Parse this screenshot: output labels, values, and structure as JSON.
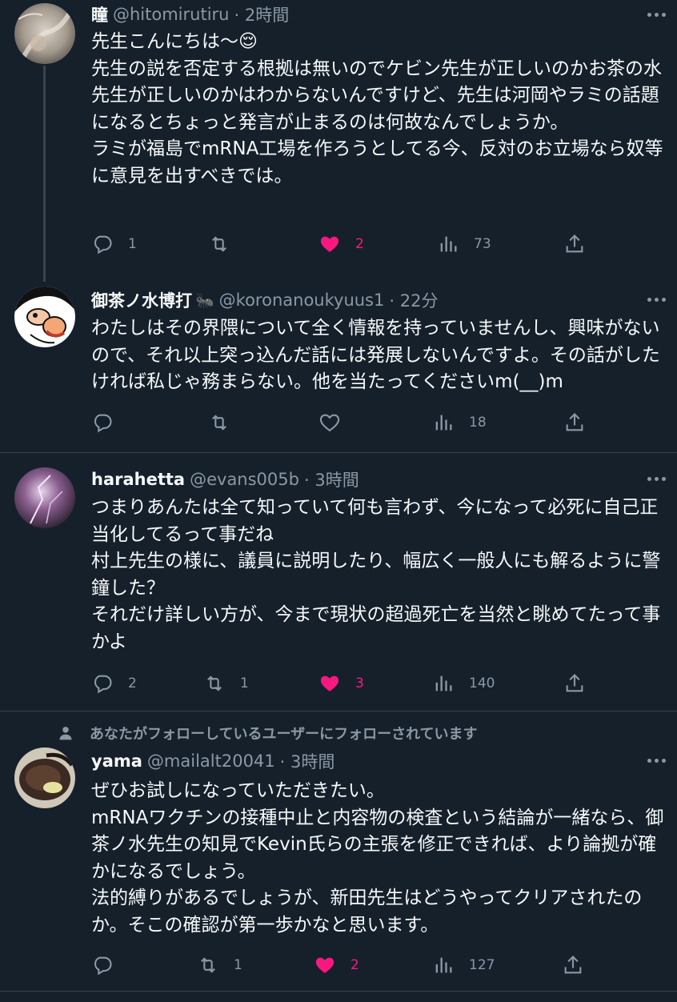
{
  "tweets": [
    {
      "name": "瞳",
      "handle": "@hitomirutiru",
      "time": "· 2時間",
      "text": "先生こんにちは〜😌\n先生の説を否定する根拠は無いのでケビン先生が正しいのかお茶の水先生が正しいのかはわからないんですけど、先生は河岡やラミの話題になるとちょっと発言が止まるのは何故なんでしょうか。\nラミが福島でmRNA工場を作ろうとしてる今、反対のお立場なら奴等に意見を出すべきでは。",
      "reply_count": "1",
      "retweet_count": "",
      "like_count": "2",
      "view_count": "73"
    },
    {
      "name": "御茶ノ水博打",
      "name_emoji": "🐜",
      "handle": "@koronanoukyuus1",
      "time": "· 22分",
      "text": "わたしはその界隈について全く情報を持っていませんし、興味がないので、それ以上突っ込んだ話には発展しないんですよ。その話がしたければ私じゃ務まらない。他を当たってくださいm(__)m",
      "reply_count": "",
      "retweet_count": "",
      "like_count": "",
      "view_count": "18"
    },
    {
      "name": "harahetta",
      "handle": "@evans005b",
      "time": "· 3時間",
      "text": "つまりあんたは全て知っていて何も言わず、今になって必死に自己正当化してるって事だね\n村上先生の様に、議員に説明したり、幅広く一般人にも解るように警鐘した？\nそれだけ詳しい方が、今まで現状の超過死亡を当然と眺めてたって事かよ",
      "reply_count": "2",
      "retweet_count": "1",
      "like_count": "3",
      "view_count": "140"
    },
    {
      "social_context": "あなたがフォローしているユーザーにフォローされています",
      "name": "yama",
      "handle": "@mailalt20041",
      "time": "· 3時間",
      "text": "ぜひお試しになっていただきたい。\nmRNAワクチンの接種中止と内容物の検査という結論が一緒なら、御茶ノ水先生の知見でKevin氏らの主張を修正できれば、より論拠が確かになるでしょう。\n法的縛りがあるでしょうが、新田先生はどうやってクリアされたのか。そこの確認が第一歩かなと思います。",
      "reply_count": "",
      "retweet_count": "1",
      "like_count": "2",
      "view_count": "127"
    }
  ],
  "colors": {
    "background": "#15202b",
    "text": "#f7f9f9",
    "secondary": "#8b98a5",
    "like": "#f91880",
    "border": "#38444d"
  }
}
